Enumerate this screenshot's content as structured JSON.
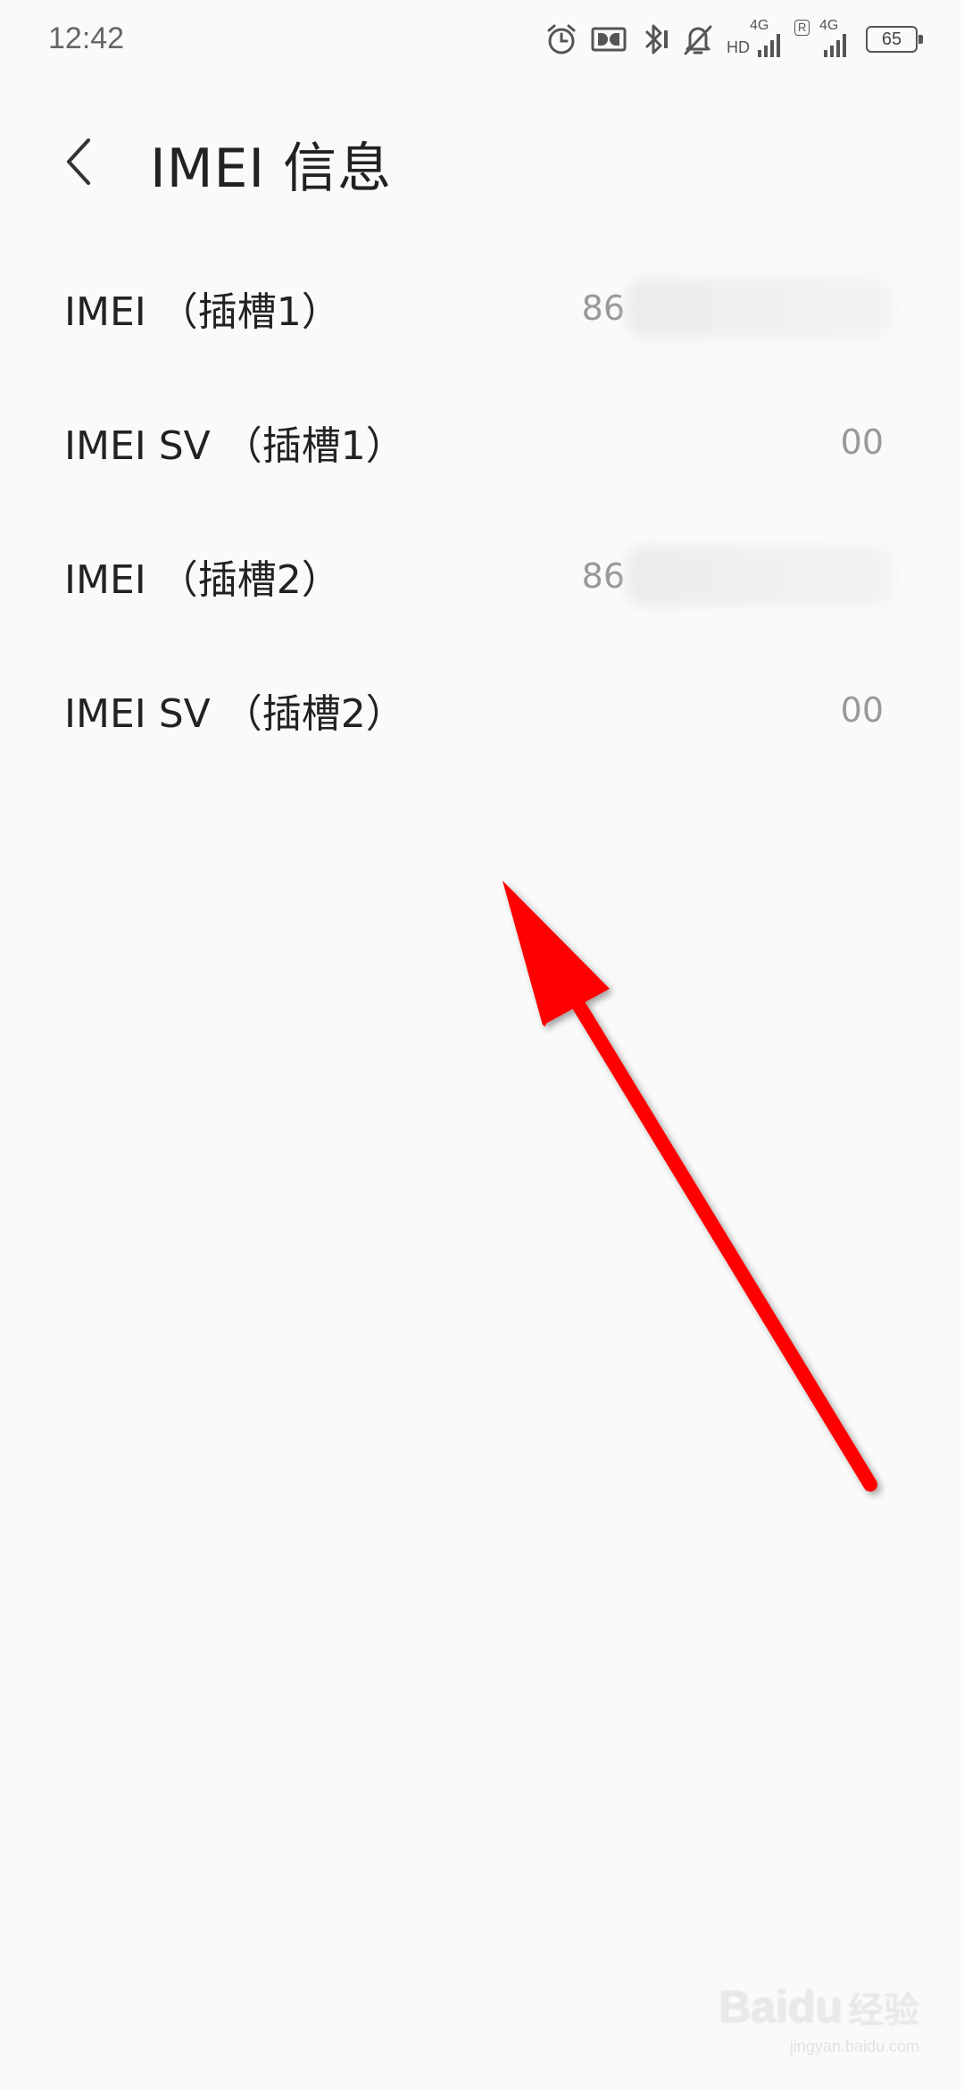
{
  "status_bar": {
    "time": "12:42",
    "icons": [
      "alarm-icon",
      "dolby-icon",
      "bluetooth-icon",
      "mute-bell-icon",
      "signal-sim1-icon",
      "signal-sim2-icon",
      "battery-icon"
    ],
    "sim1_hd": "HD",
    "sim1_network": "4G",
    "sim2_roaming": "R",
    "sim2_network": "4G",
    "battery_level": "65"
  },
  "header": {
    "back_icon": "chevron-left-icon",
    "title": "IMEI 信息"
  },
  "rows": [
    {
      "label": "IMEI （插槽1）",
      "value": "86"
    },
    {
      "label": "IMEI SV （插槽1）",
      "value": "00"
    },
    {
      "label": "IMEI （插槽2）",
      "value": "86"
    },
    {
      "label": "IMEI SV （插槽2）",
      "value": "00"
    }
  ],
  "annotation": {
    "arrow_color": "#ff0000"
  },
  "watermark": {
    "brand": "Baidu",
    "cn": "经验",
    "site": "jingyan.baidu.com"
  }
}
